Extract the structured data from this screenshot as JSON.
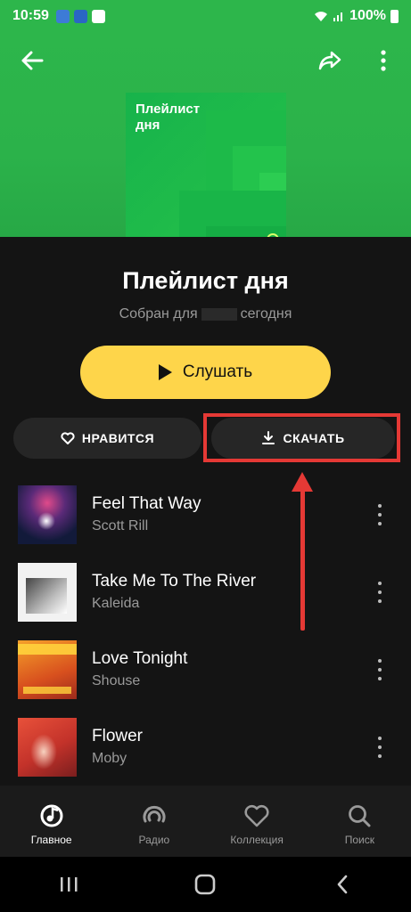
{
  "status": {
    "time": "10:59",
    "battery": "100%"
  },
  "cover": {
    "title_line1": "Плейлист",
    "title_line2": "дня"
  },
  "playlist": {
    "title": "Плейлист дня",
    "subtitle_prefix": "Собран для",
    "subtitle_suffix": "сегодня"
  },
  "actions": {
    "listen_label": "Слушать",
    "like_label": "НРАВИТСЯ",
    "download_label": "СКАЧАТЬ"
  },
  "tracks": [
    {
      "title": "Feel That Way",
      "artist": "Scott Rill"
    },
    {
      "title": "Take Me To The River",
      "artist": "Kaleida"
    },
    {
      "title": "Love Tonight",
      "artist": "Shouse"
    },
    {
      "title": "Flower",
      "artist": "Moby"
    }
  ],
  "tabs": [
    {
      "label": "Главное",
      "icon": "home-note-icon"
    },
    {
      "label": "Радио",
      "icon": "radio-icon"
    },
    {
      "label": "Коллекция",
      "icon": "heart-icon"
    },
    {
      "label": "Поиск",
      "icon": "search-icon"
    }
  ],
  "colors": {
    "header_green": "#2db64b",
    "accent_yellow": "#fed54a",
    "highlight_red": "#e53935",
    "background": "#141414"
  }
}
